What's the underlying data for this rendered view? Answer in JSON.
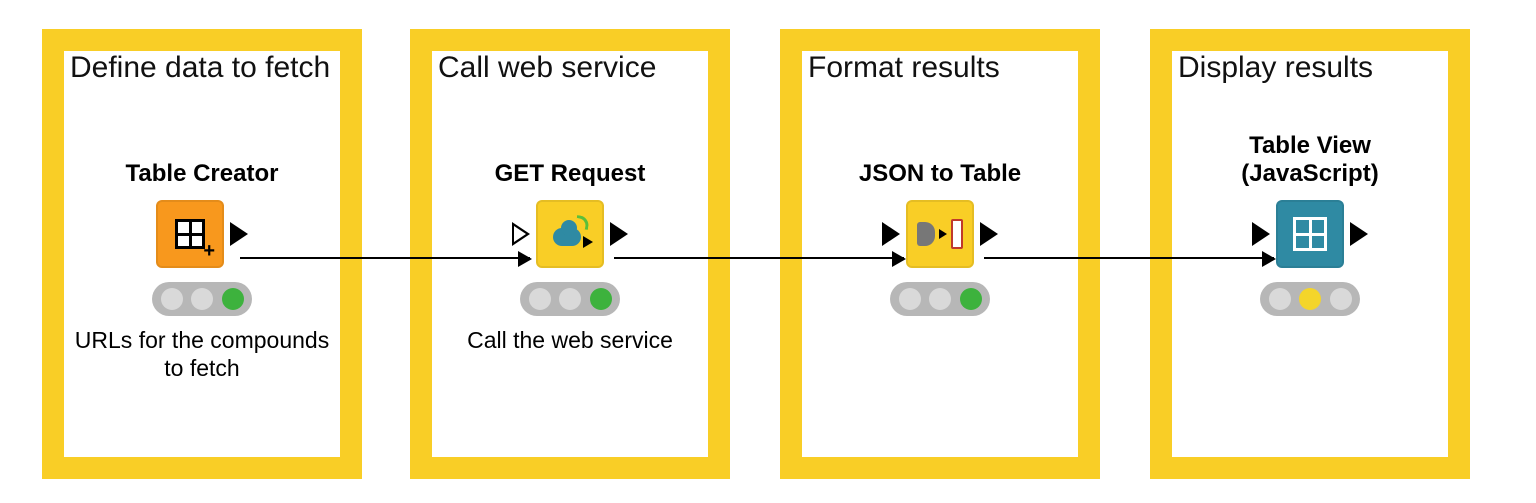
{
  "groups": [
    {
      "title": "Define data to fetch"
    },
    {
      "title": "Call web service"
    },
    {
      "title": "Format results"
    },
    {
      "title": "Display results"
    }
  ],
  "nodes": [
    {
      "name": "Table Creator",
      "caption": "URLs for the compounds to fetch",
      "tile_color": "orange",
      "icon": "table-creator-icon",
      "status": "green",
      "has_input": false,
      "has_output": true
    },
    {
      "name": "GET Request",
      "caption": "Call the web service",
      "tile_color": "yellow",
      "icon": "get-request-icon",
      "status": "green",
      "has_input": true,
      "input_hollow": true,
      "has_output": true
    },
    {
      "name": "JSON to Table",
      "caption": "",
      "tile_color": "yellow",
      "icon": "json-to-table-icon",
      "status": "green",
      "has_input": true,
      "has_output": true
    },
    {
      "name": "Table View (JavaScript)",
      "caption": "",
      "tile_color": "teal",
      "icon": "table-view-icon",
      "status": "yellow",
      "has_input": true,
      "has_output": true
    }
  ]
}
